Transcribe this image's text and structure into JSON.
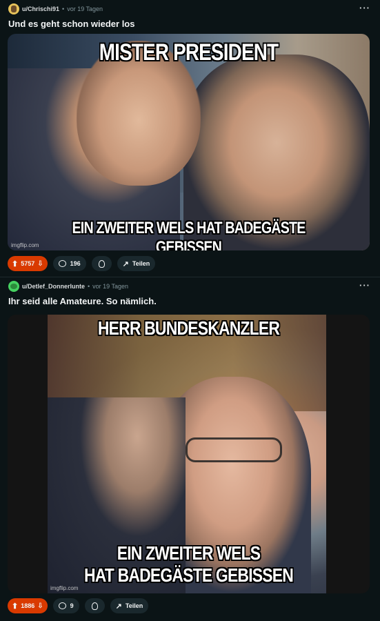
{
  "posts": [
    {
      "username": "u/Chrischi91",
      "time": "vor 19 Tagen",
      "title": "Und es geht schon wieder los",
      "meme_top": "MISTER PRESIDENT",
      "meme_bottom": "EIN ZWEITER WELS HAT BADEGÄSTE GEBISSEN",
      "watermark": "imgflip.com",
      "votes": "5757",
      "comments": "196",
      "share_label": "Teilen"
    },
    {
      "username": "u/Detlef_Donnerlunte",
      "time": "vor 19 Tagen",
      "title": "Ihr seid alle Amateure. So nämlich.",
      "meme_top": "HERR BUNDESKANZLER",
      "meme_bottom_1": "EIN ZWEITER WELS",
      "meme_bottom_2": "HAT BADEGÄSTE GEBISSEN",
      "watermark": "imgflip.com",
      "votes": "1886",
      "comments": "9",
      "share_label": "Teilen"
    }
  ],
  "ui": {
    "separator": "•",
    "more": "···",
    "icons": {
      "upvote": "arrow-up-icon",
      "downvote": "arrow-down-icon",
      "comment": "comment-bubble-icon",
      "award": "award-icon",
      "share": "share-arrow-icon"
    },
    "colors": {
      "background": "#0b1416",
      "vote_active": "#d93a00",
      "pill": "#1a282d"
    }
  }
}
